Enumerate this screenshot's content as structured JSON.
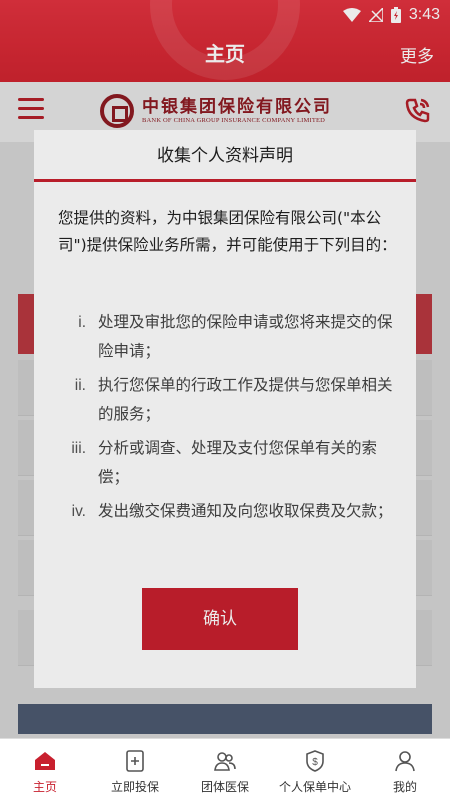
{
  "status": {
    "time": "3:43"
  },
  "header": {
    "title": "主页",
    "more": "更多"
  },
  "brand": {
    "name_cn": "中银集团保险有限公司",
    "name_en": "BANK OF CHINA GROUP INSURANCE COMPANY LIMITED"
  },
  "modal": {
    "title": "收集个人资料声明",
    "intro": "您提供的资料，为中银集团保险有限公司(\"本公司\")提供保险业务所需，并可能使用于下列目的：",
    "items": [
      {
        "num": "i.",
        "text": "处理及审批您的保险申请或您将来提交的保险申请；"
      },
      {
        "num": "ii.",
        "text": "执行您保单的行政工作及提供与您保单相关的服务；"
      },
      {
        "num": "iii.",
        "text": "分析或调查、处理及支付您保单有关的索偿；"
      },
      {
        "num": "iv.",
        "text": "发出缴交保费通知及向您收取保费及欠款；"
      }
    ],
    "confirm": "确认"
  },
  "tabbar": [
    {
      "label": "主页",
      "icon": "home-icon",
      "active": true
    },
    {
      "label": "立即投保",
      "icon": "add-document-icon"
    },
    {
      "label": "团体医保",
      "icon": "group-icon"
    },
    {
      "label": "个人保单中心",
      "icon": "shield-dollar-icon"
    },
    {
      "label": "我的",
      "icon": "user-icon"
    }
  ],
  "colors": {
    "brand_red": "#c8202e",
    "header_red": "#d62a35"
  }
}
